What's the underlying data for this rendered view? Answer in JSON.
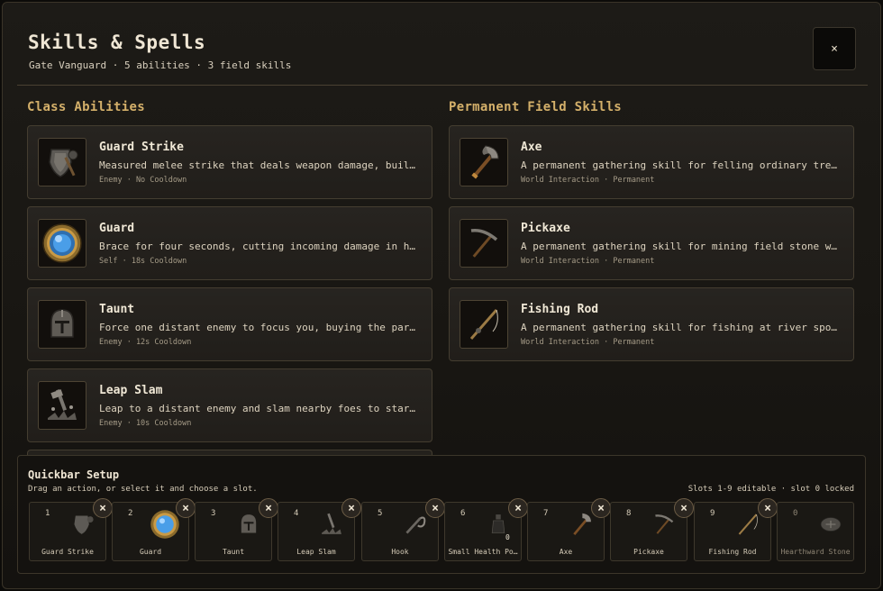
{
  "header": {
    "title": "Skills & Spells",
    "subtitle": "Gate Vanguard · 5 abilities · 3 field skills",
    "close_label": "×"
  },
  "class_abilities": {
    "title": "Class Abilities",
    "items": [
      {
        "name": "Guard Strike",
        "description": "Measured melee strike that deals weapon damage, buil…",
        "meta": "Enemy · No Cooldown",
        "icon": "shield-mace-icon"
      },
      {
        "name": "Guard",
        "description": "Brace for four seconds, cutting incoming damage in h…",
        "meta": "Self · 18s Cooldown",
        "icon": "blue-orb-icon"
      },
      {
        "name": "Taunt",
        "description": "Force one distant enemy to focus you, buying the par…",
        "meta": "Enemy · 12s Cooldown",
        "icon": "helmet-icon"
      },
      {
        "name": "Leap Slam",
        "description": "Leap to a distant enemy and slam nearby foes to star…",
        "meta": "Enemy · 10s Cooldown",
        "icon": "leap-slam-icon"
      }
    ]
  },
  "field_skills": {
    "title": "Permanent Field Skills",
    "items": [
      {
        "name": "Axe",
        "description": "A permanent gathering skill for felling ordinary tre…",
        "meta": "World Interaction · Permanent",
        "icon": "axe-icon"
      },
      {
        "name": "Pickaxe",
        "description": "A permanent gathering skill for mining field stone w…",
        "meta": "World Interaction · Permanent",
        "icon": "pickaxe-icon"
      },
      {
        "name": "Fishing Rod",
        "description": "A permanent gathering skill for fishing at river spo…",
        "meta": "World Interaction · Permanent",
        "icon": "fishing-rod-icon"
      }
    ]
  },
  "quickbar": {
    "title": "Quickbar Setup",
    "hint": "Drag an action, or select it and choose a slot.",
    "status": "Slots 1-9 editable · slot 0 locked",
    "remove_label": "×",
    "slots": [
      {
        "number": "1",
        "label": "Guard Strike",
        "icon": "shield-mace-icon"
      },
      {
        "number": "2",
        "label": "Guard",
        "icon": "blue-orb-icon"
      },
      {
        "number": "3",
        "label": "Taunt",
        "icon": "helmet-icon"
      },
      {
        "number": "4",
        "label": "Leap Slam",
        "icon": "leap-slam-icon"
      },
      {
        "number": "5",
        "label": "Hook",
        "icon": "hook-icon"
      },
      {
        "number": "6",
        "label": "Small Health Po…",
        "icon": "potion-icon",
        "quantity": "0"
      },
      {
        "number": "7",
        "label": "Axe",
        "icon": "axe-icon"
      },
      {
        "number": "8",
        "label": "Pickaxe",
        "icon": "pickaxe-icon"
      },
      {
        "number": "9",
        "label": "Fishing Rod",
        "icon": "fishing-rod-icon"
      },
      {
        "number": "0",
        "label": "Hearthward Stone",
        "icon": "hearthward-stone-icon"
      }
    ]
  },
  "colors": {
    "accent_gold": "#d4b06a",
    "panel_bg": "#1d1b17",
    "orb_blue": "#4a9ee8"
  }
}
